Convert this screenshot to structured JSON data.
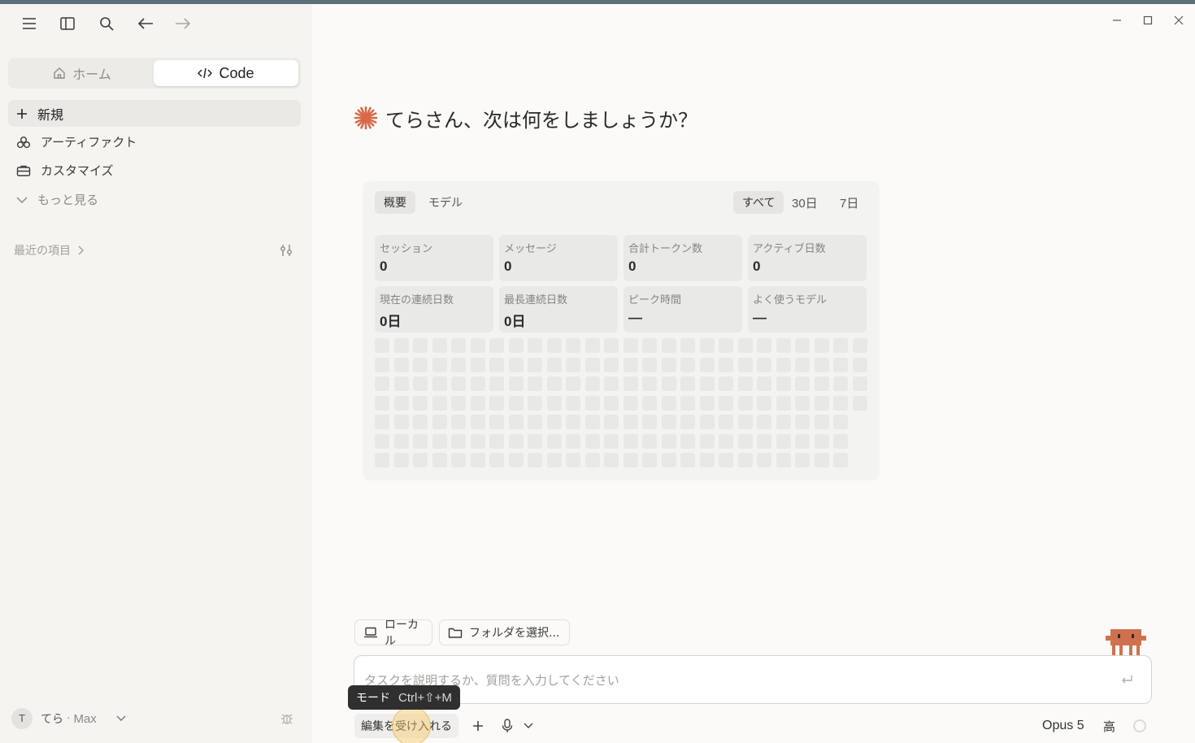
{
  "sidebar": {
    "segment": {
      "home_label": "ホーム",
      "code_label": "Code"
    },
    "items": [
      {
        "label": "新規",
        "icon": "plus-icon"
      },
      {
        "label": "アーティファクト",
        "icon": "artifacts-icon"
      },
      {
        "label": "カスタマイズ",
        "icon": "briefcase-icon"
      },
      {
        "label": "もっと見る",
        "icon": "chevron-down-icon"
      }
    ],
    "recent_label": "最近の項目",
    "user": {
      "initial": "T",
      "name": "てら",
      "sep": "·",
      "plan": "Max"
    }
  },
  "main": {
    "greeting": "てらさん、次は何をしましょうか？",
    "stats": {
      "tabs": [
        "概要",
        "モデル"
      ],
      "ranges": [
        "すべて",
        "30日",
        "7日"
      ],
      "active_range": "すべて",
      "cards": [
        {
          "label": "セッション",
          "value": "0"
        },
        {
          "label": "メッセージ",
          "value": "0"
        },
        {
          "label": "合計トークン数",
          "value": "0"
        },
        {
          "label": "アクティブ日数",
          "value": "0"
        },
        {
          "label": "現在の連続日数",
          "value": "0日"
        },
        {
          "label": "最長連続日数",
          "value": "0日"
        },
        {
          "label": "ピーク時間",
          "value": "—"
        },
        {
          "label": "よく使うモデル",
          "value": "—"
        }
      ]
    },
    "composer": {
      "local_label": "ローカル",
      "folder_label": "フォルダを選択...",
      "placeholder": "タスクを説明するか、質問を入力してください",
      "mode_label": "編集を受け入れる",
      "tooltip_label": "モード",
      "tooltip_shortcut": "Ctrl+⇧+M",
      "model": "Opus 5",
      "effort": "高"
    }
  },
  "colors": {
    "accent": "#d9694a",
    "sidebar_bg": "#f5f4f1",
    "main_bg": "#fbfaf8",
    "mascot": "#d0714e"
  }
}
